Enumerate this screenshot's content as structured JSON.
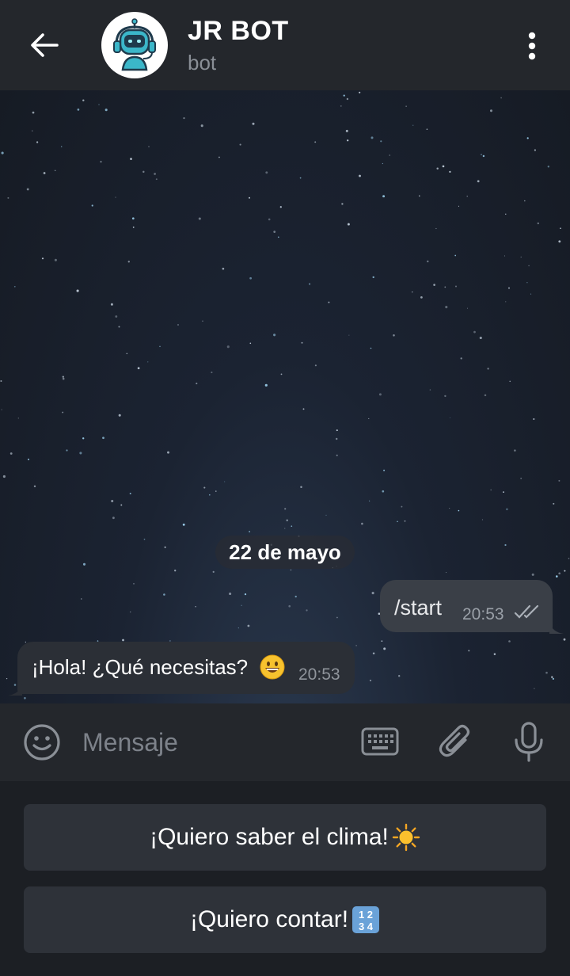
{
  "header": {
    "title": "JR BOT",
    "subtitle": "bot",
    "back_icon": "arrow-left-icon",
    "menu_icon": "more-vertical-icon",
    "avatar_icon": "robot-headset-icon"
  },
  "chat": {
    "date_separator": "22 de mayo",
    "messages": [
      {
        "direction": "outgoing",
        "text": "/start",
        "time": "20:53",
        "status_icon": "double-check-icon"
      },
      {
        "direction": "incoming",
        "text": "¡Hola! ¿Qué necesitas?",
        "emoji": "grinning-face-icon",
        "time": "20:53"
      }
    ]
  },
  "composer": {
    "placeholder": "Mensaje",
    "value": "",
    "emoji_icon": "smiley-icon",
    "keyboard_icon": "keyboard-icon",
    "attach_icon": "paperclip-icon",
    "mic_icon": "microphone-icon"
  },
  "reply_keyboard": {
    "buttons": [
      {
        "label": "¡Quiero saber el clima!",
        "icon": "sun-icon"
      },
      {
        "label": "¡Quiero contar!",
        "icon": "input-numbers-icon"
      }
    ]
  },
  "colors": {
    "header_bg": "#24272c",
    "outgoing_bubble": "#3a3f47",
    "incoming_bubble": "#2b2f36",
    "reply_button": "#2e3239",
    "muted_text": "#8a8f96"
  }
}
